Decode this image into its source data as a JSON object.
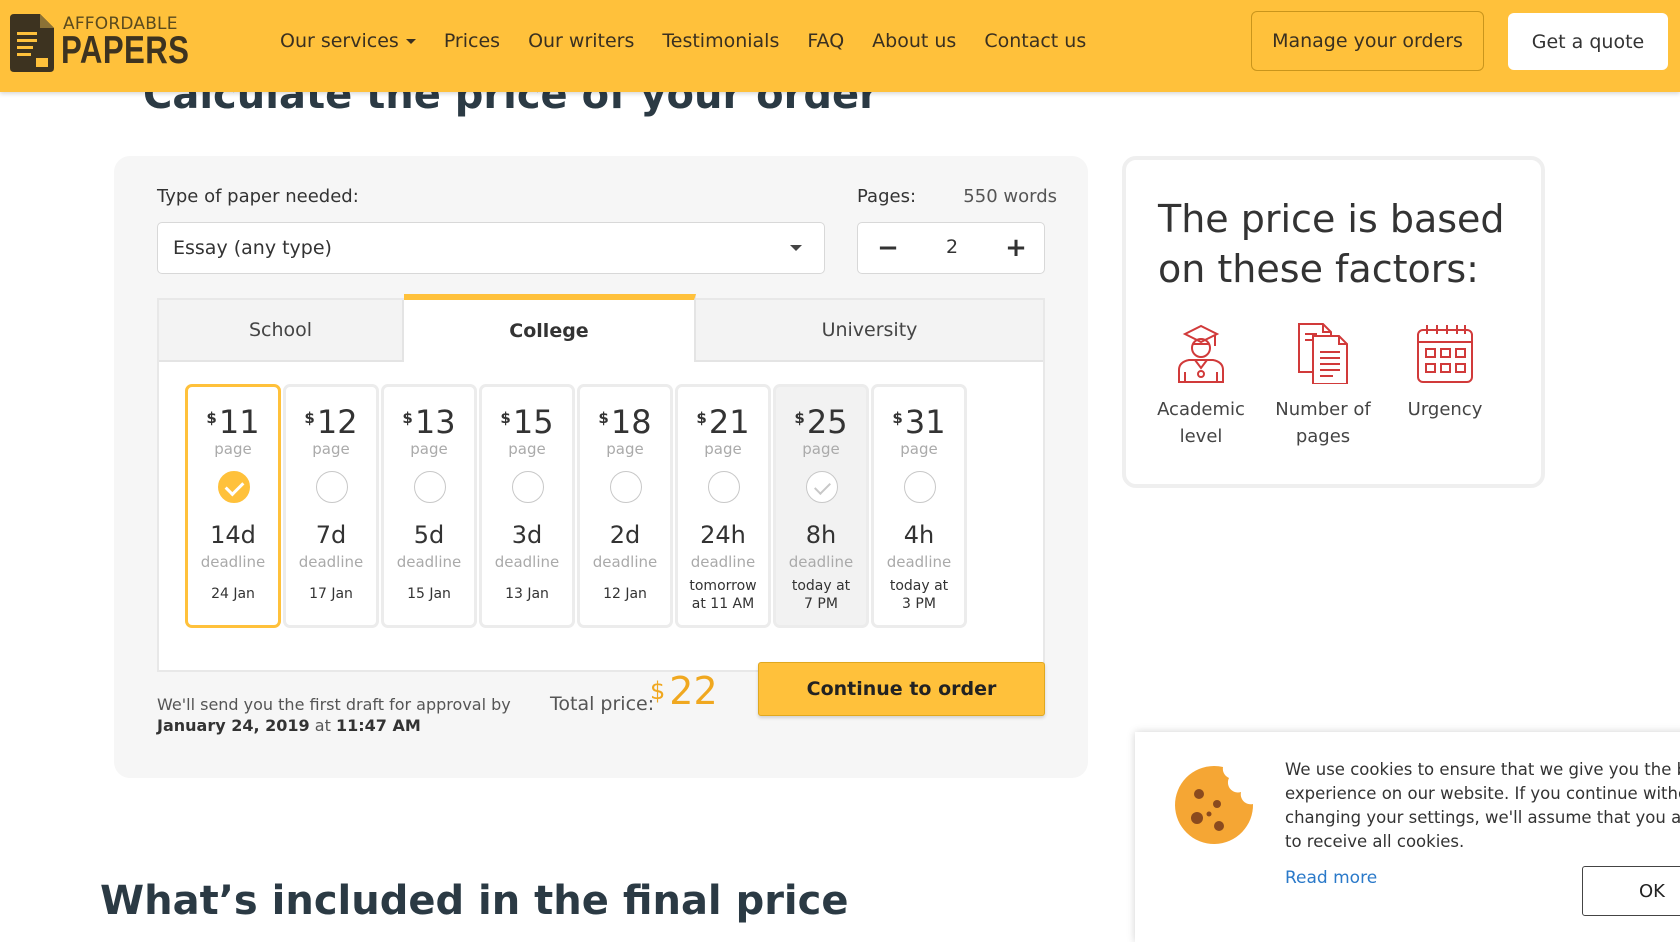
{
  "header": {
    "logo_top": "AFFORDABLE",
    "logo_bottom": "PAPERS",
    "nav": [
      "Our services",
      "Prices",
      "Our writers",
      "Testimonials",
      "FAQ",
      "About us",
      "Contact us"
    ],
    "manage_label": "Manage your orders",
    "quote_label": "Get a quote"
  },
  "page_heading": "Calculate the price of your order",
  "calculator": {
    "type_label": "Type of paper needed:",
    "type_value": "Essay (any type)",
    "pages_label": "Pages:",
    "words": "550 words",
    "pages_value": "2",
    "tabs": [
      "School",
      "College",
      "University"
    ],
    "active_tab": "College",
    "deadlines": [
      {
        "currency": "$",
        "price": "11",
        "unit": "page",
        "length": "14d",
        "word": "deadline",
        "date": "24 Jan",
        "date2": ""
      },
      {
        "currency": "$",
        "price": "12",
        "unit": "page",
        "length": "7d",
        "word": "deadline",
        "date": "17 Jan",
        "date2": ""
      },
      {
        "currency": "$",
        "price": "13",
        "unit": "page",
        "length": "5d",
        "word": "deadline",
        "date": "15 Jan",
        "date2": ""
      },
      {
        "currency": "$",
        "price": "15",
        "unit": "page",
        "length": "3d",
        "word": "deadline",
        "date": "13 Jan",
        "date2": ""
      },
      {
        "currency": "$",
        "price": "18",
        "unit": "page",
        "length": "2d",
        "word": "deadline",
        "date": "12 Jan",
        "date2": ""
      },
      {
        "currency": "$",
        "price": "21",
        "unit": "page",
        "length": "24h",
        "word": "deadline",
        "date": "tomorrow",
        "date2": "at 11 AM"
      },
      {
        "currency": "$",
        "price": "25",
        "unit": "page",
        "length": "8h",
        "word": "deadline",
        "date": "today at",
        "date2": "7 PM"
      },
      {
        "currency": "$",
        "price": "31",
        "unit": "page",
        "length": "4h",
        "word": "deadline",
        "date": "today at",
        "date2": "3 PM"
      }
    ],
    "draft_line1": "We'll send you the first draft for approval by",
    "draft_date": "January 24, 2019",
    "draft_at": "at",
    "draft_time": "11:47 AM",
    "total_label": "Total price:",
    "total_currency": "$",
    "total_value": "22",
    "continue_label": "Continue to order"
  },
  "factors": {
    "title": "The price is based on these factors:",
    "items": [
      {
        "label1": "Academic",
        "label2": "level",
        "icon": "student-icon"
      },
      {
        "label1": "Number of",
        "label2": "pages",
        "icon": "document-icon"
      },
      {
        "label1": "Urgency",
        "label2": "",
        "icon": "calendar-icon"
      }
    ]
  },
  "whats_included": "What’s included in the final price",
  "cookie": {
    "lines": [
      "We use cookies to ensure that we give you the best",
      "experience on our website. If you continue without",
      "changing your settings, we'll assume that you are ha",
      "to receive all cookies."
    ],
    "read_more": "Read more",
    "ok": "OK"
  },
  "colors": {
    "accent": "#ffc13b",
    "price": "#f0a820",
    "icon_red": "#d13a3a",
    "link": "#2a79c9"
  }
}
